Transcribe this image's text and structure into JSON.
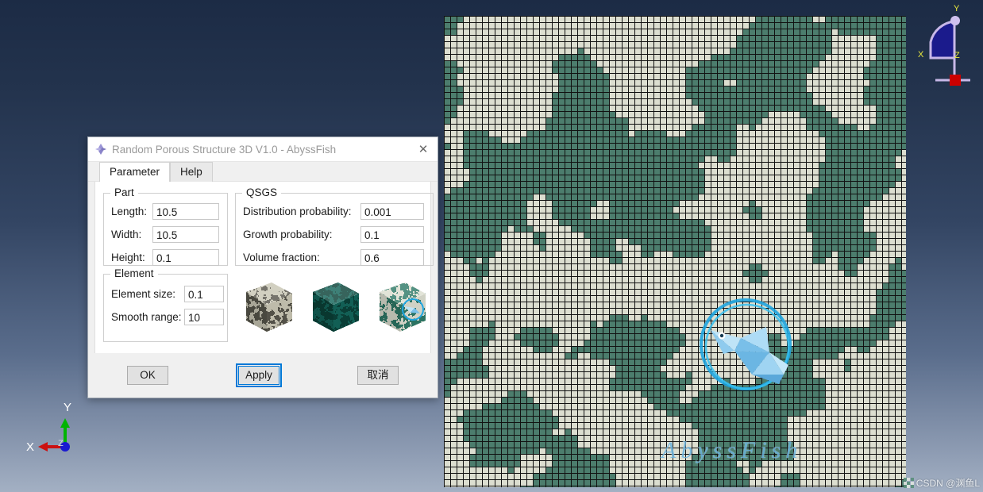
{
  "desktop": {
    "background_top": "#1c2b45",
    "background_bottom": "#a3b0c3"
  },
  "triad": {
    "name": "axis-triad",
    "x_label": "X",
    "y_label": "Y",
    "z_label": "Z",
    "x_color": "#cc1111",
    "y_color": "#00b400",
    "z_color": "#1a1ad0"
  },
  "rotate_widget": {
    "name": "view-rotation-widget",
    "x_label": "X",
    "y_label": "Y",
    "z_label": "Z",
    "fill_color": "#1b1b8c",
    "edge_color": "#c8b8e8",
    "label_color": "#e8e83c",
    "handle_color": "#cc0000"
  },
  "viewport": {
    "name": "mesh-viewport",
    "watermark": "AbyssFish",
    "mesh_light_color": "#dcded0",
    "mesh_dark_color": "#4c7d6d",
    "mesh_line_color": "#111111",
    "cell_size_px": 8,
    "fish_logo_color": "#59b8e8"
  },
  "csdn": {
    "text": "CSDN @渊鱼L"
  },
  "dialog": {
    "title": "Random Porous Structure 3D V1.0 - AbyssFish",
    "icon": "diamond-app-icon",
    "close_label": "✕",
    "tabs": [
      {
        "label": "Parameter",
        "active": true
      },
      {
        "label": "Help",
        "active": false
      }
    ],
    "groups": {
      "part": {
        "legend": "Part",
        "fields": [
          {
            "label": "Length:",
            "value": "10.5"
          },
          {
            "label": "Width:",
            "value": "10.5"
          },
          {
            "label": "Height:",
            "value": "0.1"
          }
        ]
      },
      "qsgs": {
        "legend": "QSGS",
        "fields": [
          {
            "label": "Distribution probability:",
            "value": "0.001"
          },
          {
            "label": "Growth probability:",
            "value": "0.1"
          },
          {
            "label": "Volume fraction:",
            "value": "0.6"
          }
        ]
      },
      "element": {
        "legend": "Element",
        "fields": [
          {
            "label": "Element size:",
            "value": "0.1"
          },
          {
            "label": "Smooth range:",
            "value": "10"
          }
        ]
      }
    },
    "thumbnails": [
      {
        "name": "preview-cube-gray",
        "base": "#c9c6b4",
        "speck": "#58564c"
      },
      {
        "name": "preview-cube-teal",
        "base": "#14655a",
        "speck": "#0b4239"
      },
      {
        "name": "preview-cube-mixed",
        "base": "#dcded0",
        "speck": "#2f7a68"
      }
    ],
    "buttons": [
      {
        "name": "ok-button",
        "label": "OK",
        "focused": false
      },
      {
        "name": "apply-button",
        "label": "Apply",
        "focused": true
      },
      {
        "name": "cancel-button",
        "label": "取消",
        "focused": false
      }
    ]
  }
}
